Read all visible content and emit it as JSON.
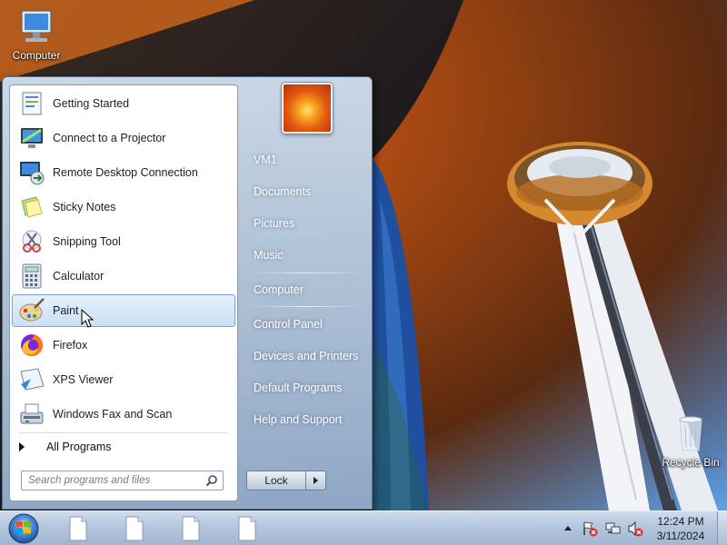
{
  "desktop": {
    "icons": [
      {
        "label": "Computer"
      },
      {
        "label": "Recycle Bin"
      }
    ]
  },
  "start_menu": {
    "programs": [
      {
        "label": "Getting Started",
        "icon": "getting-started-icon"
      },
      {
        "label": "Connect to a Projector",
        "icon": "projector-icon"
      },
      {
        "label": "Remote Desktop Connection",
        "icon": "remote-desktop-icon"
      },
      {
        "label": "Sticky Notes",
        "icon": "sticky-notes-icon"
      },
      {
        "label": "Snipping Tool",
        "icon": "snipping-tool-icon"
      },
      {
        "label": "Calculator",
        "icon": "calculator-icon"
      },
      {
        "label": "Paint",
        "icon": "paint-icon",
        "highlighted": true
      },
      {
        "label": "Firefox",
        "icon": "firefox-icon"
      },
      {
        "label": "XPS Viewer",
        "icon": "xps-viewer-icon"
      },
      {
        "label": "Windows Fax and Scan",
        "icon": "fax-scan-icon"
      }
    ],
    "all_programs_label": "All Programs",
    "search_placeholder": "Search programs and files",
    "right_items": [
      {
        "label": "VM1"
      },
      {
        "label": "Documents"
      },
      {
        "label": "Pictures"
      },
      {
        "label": "Music"
      },
      {
        "label": "Computer"
      },
      {
        "label": "Control Panel"
      },
      {
        "label": "Devices and Printers"
      },
      {
        "label": "Default Programs"
      },
      {
        "label": "Help and Support"
      }
    ],
    "lock_label": "Lock"
  },
  "taskbar": {
    "pinned": [
      {
        "icon": "document-icon"
      },
      {
        "icon": "document-icon"
      },
      {
        "icon": "document-icon"
      },
      {
        "icon": "document-icon"
      }
    ],
    "tray_icons": [
      "show-hidden-icons-arrow",
      "action-center-flag-icon",
      "network-icon",
      "volume-muted-icon"
    ],
    "time": "12:24 PM",
    "date": "3/11/2024"
  }
}
